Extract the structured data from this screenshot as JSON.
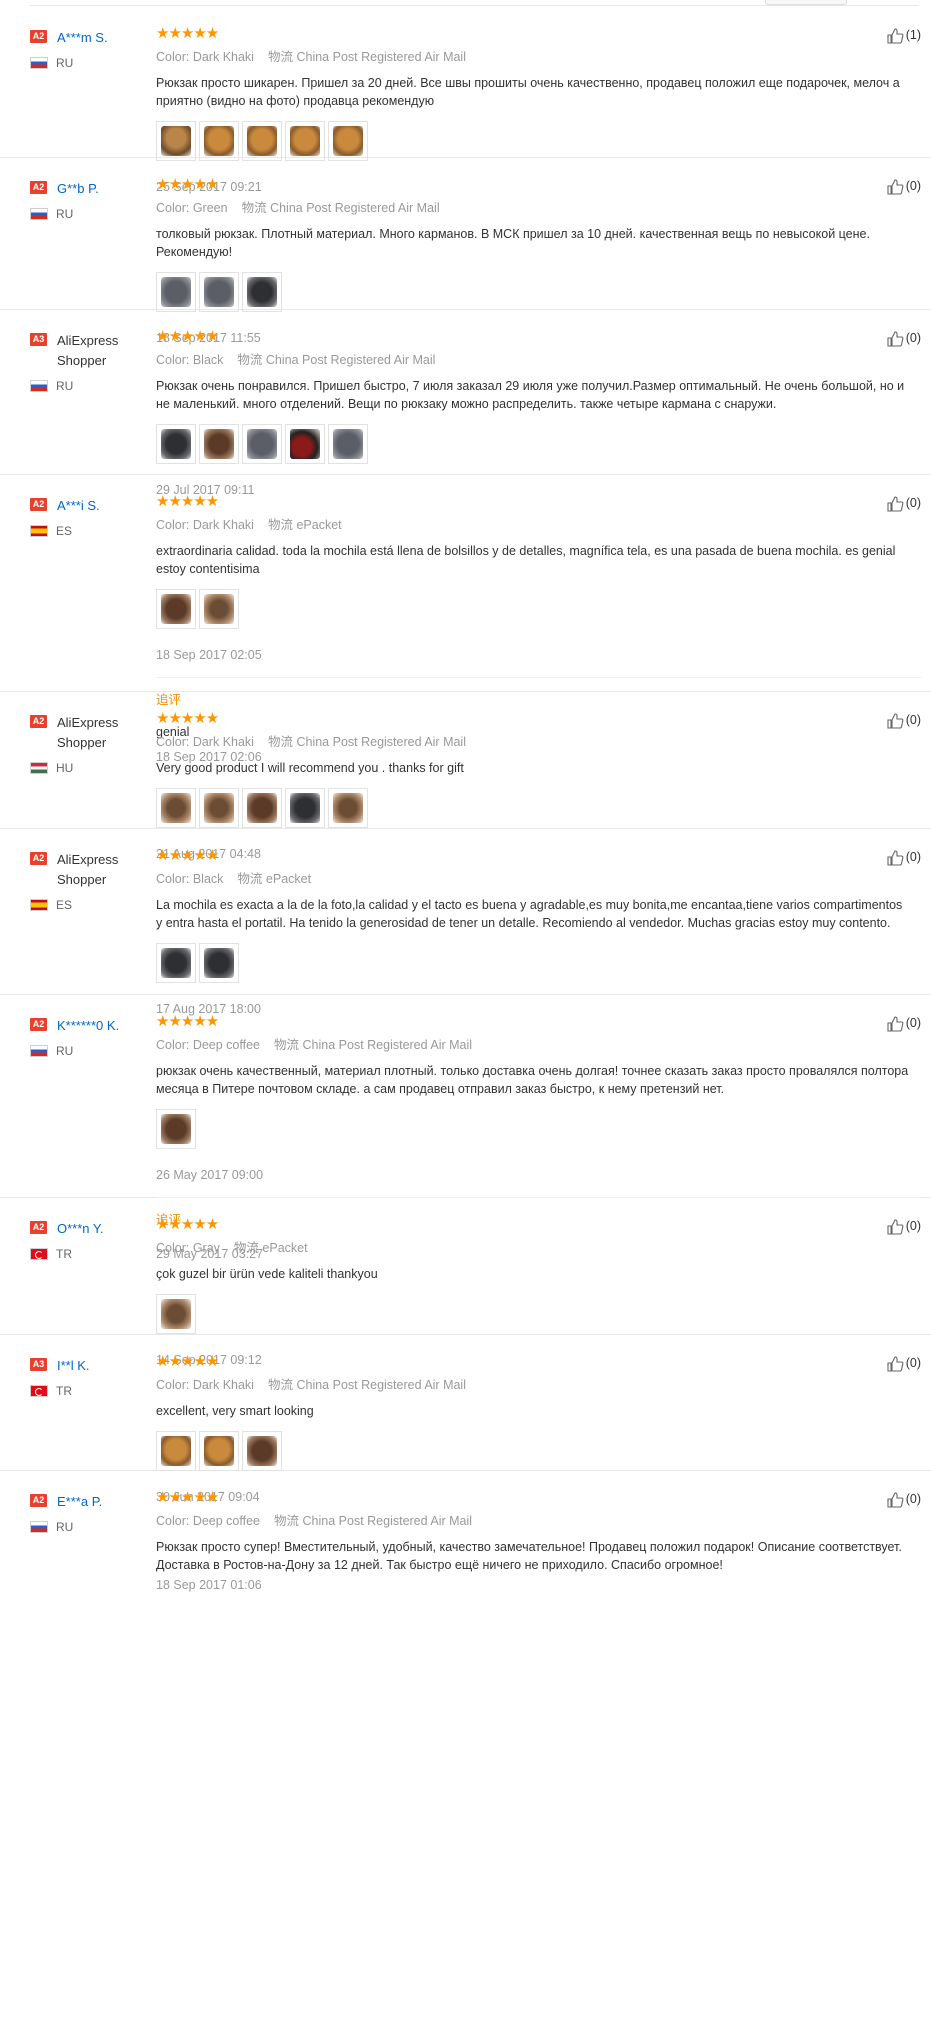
{
  "meta_labels": {
    "color": "Color:",
    "shipping": "物流"
  },
  "reviews": [
    {
      "level": "A2",
      "name": "A***m S.",
      "country_code": "RU",
      "flag": "ru",
      "stars": 5,
      "color": "Dark Khaki",
      "shipping": "China Post Registered Air Mail",
      "text": "Рюкзак просто шикарен. Пришел за 20 дней. Все швы прошиты очень качественно, продавец положил еще подарочек, мелоч а приятно (видно на фото) продавца рекомендую",
      "photo_count": 5,
      "photo_styles": [
        "khaki2",
        "khaki",
        "khaki",
        "khaki",
        "khaki"
      ],
      "date": "25 Sep 2017 09:21",
      "likes": "(1)"
    },
    {
      "level": "A2",
      "name": "G**b P.",
      "country_code": "RU",
      "flag": "ru",
      "stars": 5,
      "color": "Green",
      "shipping": "China Post Registered Air Mail",
      "text": "толковый рюкзак. Плотный материал. Много карманов. В МСК пришел за 10 дней. качественная вещь по невысокой цене. Рекомендую!",
      "photo_count": 3,
      "photo_styles": [
        "gray",
        "gray",
        "dark"
      ],
      "date": "18 Sep 2017 11:55",
      "likes": "(0)"
    },
    {
      "level": "A3",
      "name": "AliExpress Shopper",
      "multiline": true,
      "country_code": "RU",
      "flag": "ru",
      "stars": 5,
      "color": "Black",
      "shipping": "China Post Registered Air Mail",
      "text": "Рюкзак очень понравился. Пришел быстро, 7 июля заказал 29 июля уже получил.Размер оптимальный. Не очень большой, но и не маленький. много отделений. Вещи по рюкзаку можно распределить. также четыре кармана с снаружи.",
      "photo_count": 5,
      "photo_styles": [
        "dark",
        "brown",
        "gray",
        "red",
        "gray"
      ],
      "date": "29 Jul 2017 09:11",
      "likes": "(0)"
    },
    {
      "level": "A2",
      "name": "A***i S.",
      "country_code": "ES",
      "flag": "es",
      "stars": 5,
      "color": "Dark Khaki",
      "shipping": "ePacket",
      "text": "extraordinaria calidad. toda la mochila está llena de bolsillos y de detalles, magnífica tela, es una pasada de buena mochila. es genial estoy contentisima",
      "photo_count": 2,
      "photo_styles": [
        "brown",
        "wood"
      ],
      "date": "18 Sep 2017 02:05",
      "addon": {
        "label": "追评",
        "text": "genial",
        "date": "18 Sep 2017 02:06"
      },
      "likes": "(0)"
    },
    {
      "level": "A2",
      "name": "AliExpress Shopper",
      "multiline": true,
      "country_code": "HU",
      "flag": "hu",
      "stars": 5,
      "color": "Dark Khaki",
      "shipping": "China Post Registered Air Mail",
      "text": "Very good product I will recommend you . thanks for gift",
      "photo_count": 5,
      "photo_styles": [
        "wood",
        "wood",
        "brown",
        "dark",
        "wood"
      ],
      "date": "21 Aug 2017 04:48",
      "likes": "(0)"
    },
    {
      "level": "A2",
      "name": "AliExpress Shopper",
      "multiline": true,
      "country_code": "ES",
      "flag": "es",
      "stars": 5,
      "color": "Black",
      "shipping": "ePacket",
      "text": "La mochila es exacta a la de la foto,la calidad y el tacto es buena y agradable,es muy bonita,me encantaa,tiene varios compartimentos y entra hasta el portatil. Ha tenido la generosidad de tener un detalle. Recomiendo al vendedor. Muchas gracias estoy muy contento.",
      "photo_count": 2,
      "photo_styles": [
        "dark",
        "dark"
      ],
      "date": "17 Aug 2017 18:00",
      "likes": "(0)"
    },
    {
      "level": "A2",
      "name": "K******0 K.",
      "country_code": "RU",
      "flag": "ru",
      "stars": 5,
      "color": "Deep coffee",
      "shipping": "China Post Registered Air Mail",
      "text": "рюкзак очень качественный, материал плотный. только доставка очень долгая! точнее сказать заказ просто провалялся полтора месяца в Питере почтовом складе. а сам продавец отправил заказ быстро, к нему претензий нет.",
      "photo_count": 1,
      "photo_styles": [
        "brown"
      ],
      "date": "26 May 2017 09:00",
      "addon": {
        "label": "追评",
        "text": "",
        "date": "29 May 2017 03:27"
      },
      "likes": "(0)"
    },
    {
      "level": "A2",
      "name": "O***n Y.",
      "country_code": "TR",
      "flag": "tr",
      "stars": 5,
      "color": "Gray",
      "shipping": "ePacket",
      "text": "çok guzel bir ürün vede kaliteli thankyou",
      "photo_count": 1,
      "photo_styles": [
        "wood"
      ],
      "date": "14 Sep 2017 09:12",
      "likes": "(0)"
    },
    {
      "level": "A3",
      "name": "I**l K.",
      "country_code": "TR",
      "flag": "tr",
      "stars": 5,
      "color": "Dark Khaki",
      "shipping": "China Post Registered Air Mail",
      "text": "excellent, very smart looking",
      "photo_count": 3,
      "photo_styles": [
        "khaki",
        "khaki",
        "brown"
      ],
      "date": "30 Jun 2017 09:04",
      "likes": "(0)"
    },
    {
      "level": "A2",
      "name": "E***a P.",
      "country_code": "RU",
      "flag": "ru",
      "stars": 5,
      "color": "Deep coffee",
      "shipping": "China Post Registered Air Mail",
      "text": "Рюкзак просто супер! Вместительный, удобный, качество замечательное! Продавец положил подарок! Описание соответствует. Доставка в Ростов-на-Дону за 12 дней. Так быстро ещё ничего не приходило. Спасибо огромное!",
      "photo_count": 0,
      "photo_styles": [],
      "date": "18 Sep 2017 01:06",
      "likes": "(0)"
    }
  ]
}
